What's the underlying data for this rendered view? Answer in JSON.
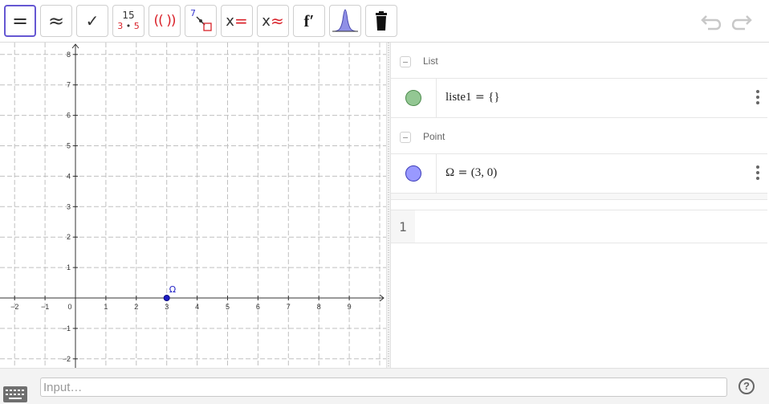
{
  "toolbar": {
    "tools": [
      {
        "name": "equals-tool",
        "symbol": "="
      },
      {
        "name": "approx-tool",
        "symbol": "≈"
      },
      {
        "name": "check-tool",
        "symbol": "✓"
      },
      {
        "name": "factor-tool",
        "top": "15",
        "bottom_a": "3",
        "bottom_dot": "•",
        "bottom_b": "5"
      },
      {
        "name": "expand-tool",
        "symbol": "(( ))"
      },
      {
        "name": "substitute-tool",
        "top": "7"
      },
      {
        "name": "solve-tool",
        "x": "x",
        "op": "="
      },
      {
        "name": "nsolve-tool",
        "x": "x",
        "op": "≈"
      },
      {
        "name": "derivative-tool",
        "symbol": "f′"
      },
      {
        "name": "probability-tool"
      },
      {
        "name": "delete-tool"
      }
    ]
  },
  "graph": {
    "x_ticks": [
      "−2",
      "−1",
      "0",
      "1",
      "2",
      "3",
      "4",
      "5",
      "6",
      "7",
      "8",
      "9"
    ],
    "y_ticks": [
      "8",
      "7",
      "6",
      "5",
      "4",
      "3",
      "2",
      "1",
      "−1",
      "−2"
    ],
    "point_label": "Ω",
    "point_color": "#1c1cc4"
  },
  "algebra": {
    "categories": [
      {
        "label": "List"
      },
      {
        "label": "Point"
      }
    ],
    "rows": [
      {
        "name_part": "liste1",
        "eq": " = ",
        "value": "{}",
        "marble_color": "#93c793"
      },
      {
        "name_part": "Ω",
        "eq": " = ",
        "value": "(3, 0)",
        "marble_color": "#9999ff"
      }
    ],
    "input_row_number": "1"
  },
  "bottom": {
    "input_placeholder": "Input…",
    "help_label": "?"
  },
  "colors": {
    "accent": "#6557d2",
    "red": "#d9222a"
  }
}
